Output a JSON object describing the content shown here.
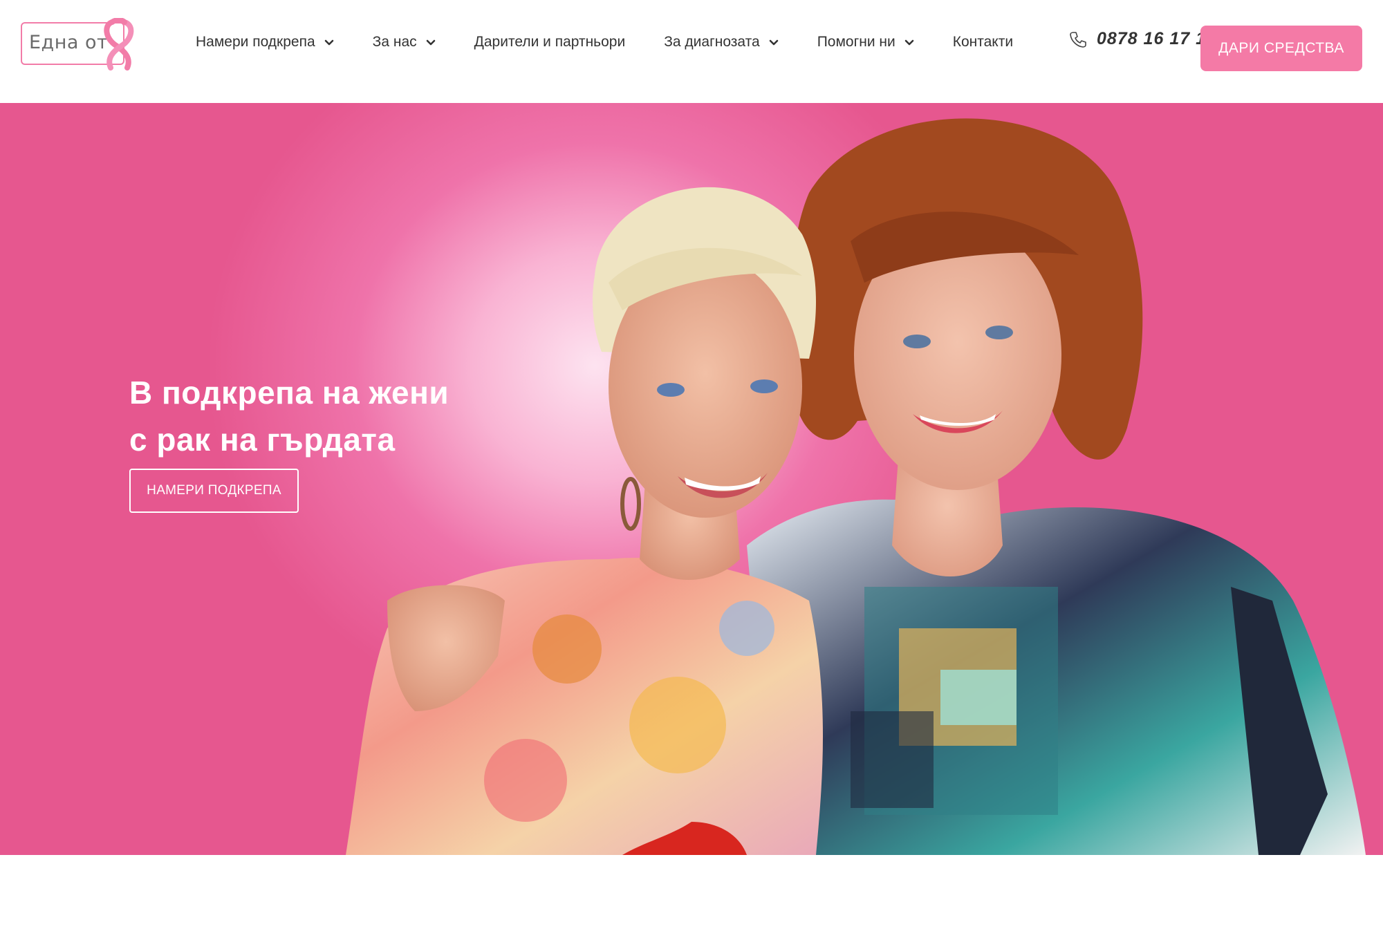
{
  "brand": {
    "logo_text": "Една от",
    "accent_color": "#f47aa6"
  },
  "nav": {
    "items": [
      {
        "label": "Намери подкрепа",
        "has_dropdown": true
      },
      {
        "label": "За нас",
        "has_dropdown": true
      },
      {
        "label": "Дарители и партньори",
        "has_dropdown": false
      },
      {
        "label": "За диагнозата",
        "has_dropdown": true
      },
      {
        "label": "Помогни ни",
        "has_dropdown": true
      },
      {
        "label": "Контакти",
        "has_dropdown": false
      }
    ],
    "phone_icon": "phone-icon",
    "phone_number": "0878 16 17 1",
    "donate_label": "ДАРИ СРЕДСТВА"
  },
  "hero": {
    "title_line1": "В подкрепа на жени",
    "title_line2": "с рак на гърдата",
    "cta_label": "НАМЕРИ ПОДКРЕПА",
    "background_color": "#ee6aa2"
  }
}
